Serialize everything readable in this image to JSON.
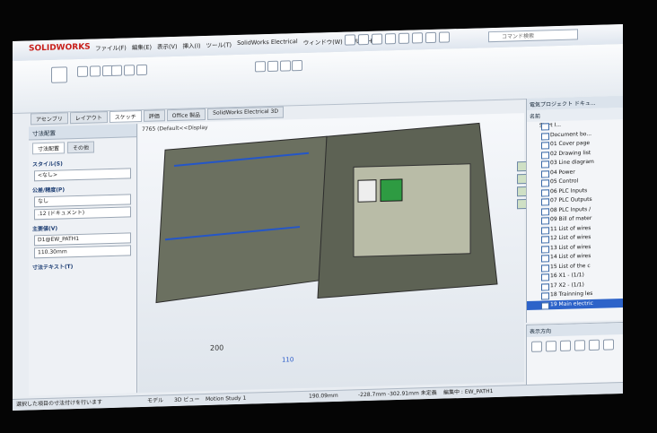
{
  "app": {
    "logo": "SOLIDWORKS"
  },
  "menu": [
    "ファイル(F)",
    "編集(E)",
    "表示(V)",
    "挿入(I)",
    "ツール(T)",
    "SolidWorks Electrical",
    "ウィンドウ(W)",
    "ヘルプ(H)"
  ],
  "search_placeholder": "コマンド検索",
  "tabs": [
    "アセンブリ",
    "レイアウト",
    "スケッチ",
    "評価",
    "Office 製品",
    "SolidWorks Electrical 3D"
  ],
  "left_panel": {
    "title": "寸法配置",
    "tabs": [
      "寸法配置",
      "その他"
    ],
    "sections": [
      "スタイル(S)",
      "公差/精度(P)",
      "主要値(V)",
      "寸法テキスト(T)"
    ],
    "values": [
      "<なし>",
      "なし",
      ".12 (ドキュメント)",
      "D1@EW_PATH1",
      "110.30mm"
    ]
  },
  "viewport": {
    "title": "7765 (Default<<Display",
    "dim1": "200",
    "dim2": "110"
  },
  "right_panel": {
    "title": "電気プロジェクト ドキュ...",
    "col": "名前",
    "root": "Start I...",
    "items": [
      "Document bo...",
      "01 Cover page",
      "02 Drawing list",
      "03 Line diagram",
      "04 Power",
      "05 Control",
      "06 PLC Inputs",
      "07 PLC Outputs",
      "08 PLC Inputs /",
      "09 Bill of mater",
      "11 List of wires",
      "12 List of wires",
      "13 List of wires",
      "14 List of wires",
      "15 List of the c",
      "16 X1 - (1/1)",
      "17 X2 - (1/1)",
      "18 Trainning les",
      "19 Main electric"
    ]
  },
  "views": {
    "title": "表示方向"
  },
  "status": {
    "tabs": [
      "モデル",
      "3D ビュー",
      "Motion Study 1"
    ],
    "hint": "選択した項目の寸法付けを行います",
    "length": "190.09mm",
    "coords": "-228.7mm -302.91mm 未定義",
    "edit": "編集中 : EW_PATH1"
  }
}
